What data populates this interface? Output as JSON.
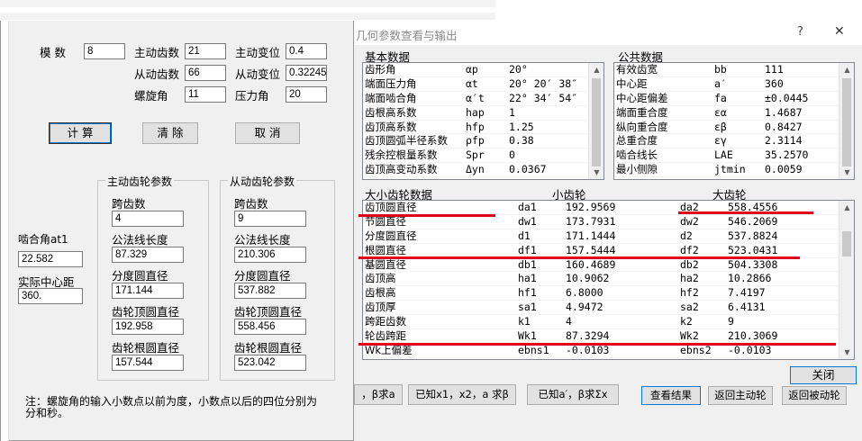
{
  "left_form": {
    "row1": {
      "module_label": "模 数",
      "module_value": "8",
      "driving_teeth_label": "主动齿数",
      "driving_teeth_value": "21",
      "driving_shift_label": "主动变位",
      "driving_shift_value": "0.4"
    },
    "row2": {
      "driven_teeth_label": "从动齿数",
      "driven_teeth_value": "66",
      "driven_shift_label": "从动变位",
      "driven_shift_value": "0.322456"
    },
    "row3": {
      "helix_label": "螺旋角",
      "helix_value": "11",
      "pressure_label": "压力角",
      "pressure_value": "20"
    },
    "buttons": {
      "calc": "计 算",
      "clear": "清 除",
      "cancel": "取 消"
    },
    "mesh_angle_label": "啮合角at1",
    "mesh_angle_value": "22.582",
    "center_dist_label": "实际中心距",
    "center_dist_value": "360.",
    "driving_group": {
      "title": "主动齿轮参数",
      "span_teeth_label": "跨齿数",
      "span_teeth_value": "4",
      "normal_len_label": "公法线长度",
      "normal_len_value": "87.329",
      "pitch_dia_label": "分度圆直径",
      "pitch_dia_value": "171.144",
      "tip_dia_label": "齿轮顶圆直径",
      "tip_dia_value": "192.958",
      "root_dia_label": "齿轮根圆直径",
      "root_dia_value": "157.544"
    },
    "driven_group": {
      "title": "从动齿轮参数",
      "span_teeth_label": "跨齿数",
      "span_teeth_value": "9",
      "normal_len_label": "公法线长度",
      "normal_len_value": "210.306",
      "pitch_dia_label": "分度圆直径",
      "pitch_dia_value": "537.882",
      "tip_dia_label": "齿轮顶圆直径",
      "tip_dia_value": "558.456",
      "root_dia_label": "齿轮根圆直径",
      "root_dia_value": "523.042"
    },
    "note": "注：螺旋角的输入小数点以前为度，小数点以后的四位分别为分和秒。"
  },
  "dialog": {
    "title": "几何参数查看与输出",
    "help": "?",
    "close": "✕",
    "basic_title": "基本数据",
    "basic_rows": [
      [
        "齿形角",
        "αp",
        "20°"
      ],
      [
        "端面压力角",
        "αt",
        "20° 20′ 38″"
      ],
      [
        "端面啮合角",
        "α′t",
        "22° 34′ 54″"
      ],
      [
        "齿根高系数",
        "hap",
        "1"
      ],
      [
        "齿顶高系数",
        "hfp",
        "1.25"
      ],
      [
        "齿顶圆弧半径系数",
        "ρfp",
        "0.38"
      ],
      [
        "残余控根量系数",
        "Spr",
        "0"
      ],
      [
        "齿顶高变动系数",
        "Δyn",
        "0.0367"
      ]
    ],
    "common_title": "公共数据",
    "common_rows": [
      [
        "有效齿宽",
        "bb",
        "111"
      ],
      [
        "中心距",
        "a′",
        "360"
      ],
      [
        "中心距偏差",
        "fa",
        "±0.0445"
      ],
      [
        "端面重合度",
        "εα",
        "1.4687"
      ],
      [
        "纵向重合度",
        "εβ",
        "0.8427"
      ],
      [
        "总重合度",
        "εγ",
        "2.3114"
      ],
      [
        "啮合线长",
        "LAE",
        "35.2570"
      ],
      [
        "最小侧隙",
        "jtmin",
        "0.0059"
      ]
    ],
    "gear_title": "大小齿轮数据",
    "small_gear": "小齿轮",
    "large_gear": "大齿轮",
    "gear_rows": [
      [
        "齿顶圆直径",
        "da1",
        "192.9569",
        "da2",
        "558.4556"
      ],
      [
        "节圆直径",
        "dw1",
        "173.7931",
        "dw2",
        "546.2069"
      ],
      [
        "分度圆直径",
        "d1",
        "171.1444",
        "d2",
        "537.8824"
      ],
      [
        "根圆直径",
        "df1",
        "157.5444",
        "df2",
        "523.0431"
      ],
      [
        "基圆直径",
        "db1",
        "160.4689",
        "db2",
        "504.3308"
      ],
      [
        "齿顶高",
        "ha1",
        "10.9062",
        "ha2",
        "10.2866"
      ],
      [
        "齿根高",
        "hf1",
        "6.8000",
        "hf2",
        "7.4197"
      ],
      [
        "齿顶厚",
        "sa1",
        "4.9472",
        "sa2",
        "6.4131"
      ],
      [
        "跨距齿数",
        "k1",
        "4",
        "k2",
        "9"
      ],
      [
        "轮齿跨距",
        "Wk1",
        "87.3294",
        "Wk2",
        "210.3069"
      ],
      [
        "Wk上偏差",
        "ebns1",
        "-0.0103",
        "ebns2",
        "-0.0103"
      ]
    ],
    "close_button": "关闭"
  },
  "background_buttons": {
    "b1": "，β求a",
    "b2": "已知x1，x2，a 求β",
    "b3": "已知a′，β求Σx",
    "b4": "查看结果",
    "b5": "返回主动轮",
    "b6": "返回被动轮"
  }
}
